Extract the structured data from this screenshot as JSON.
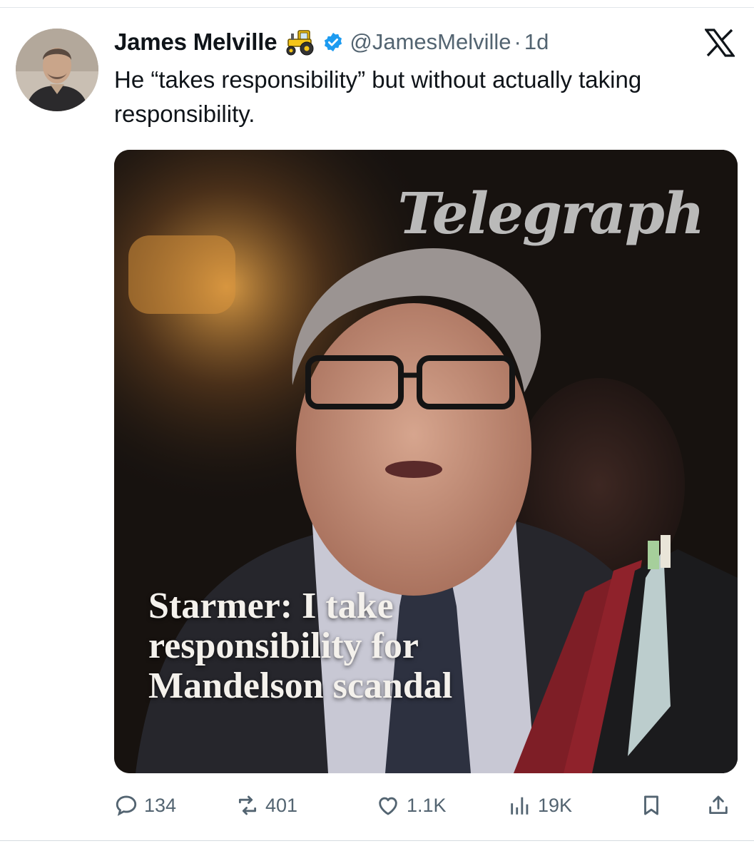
{
  "tweet": {
    "display_name": "James Melville",
    "name_emoji_icon": "tractor-icon",
    "verified_icon": "verified-badge-icon",
    "handle": "@JamesMelville",
    "separator": "·",
    "time": "1d",
    "platform_icon": "x-logo-icon",
    "text": "He “takes responsibility” but without actually taking responsibility."
  },
  "media": {
    "masthead": "Telegraph",
    "headline": "Starmer: I take responsibility for Mandelson scandal"
  },
  "actions": {
    "replies": "134",
    "reposts": "401",
    "likes": "1.1K",
    "views": "19K",
    "bookmark_icon": "bookmark-icon",
    "share_icon": "share-icon"
  },
  "colors": {
    "text_primary": "#0f1419",
    "text_secondary": "#536471",
    "verified_blue": "#1d9bf0",
    "tractor_yellow": "#f5c518"
  }
}
